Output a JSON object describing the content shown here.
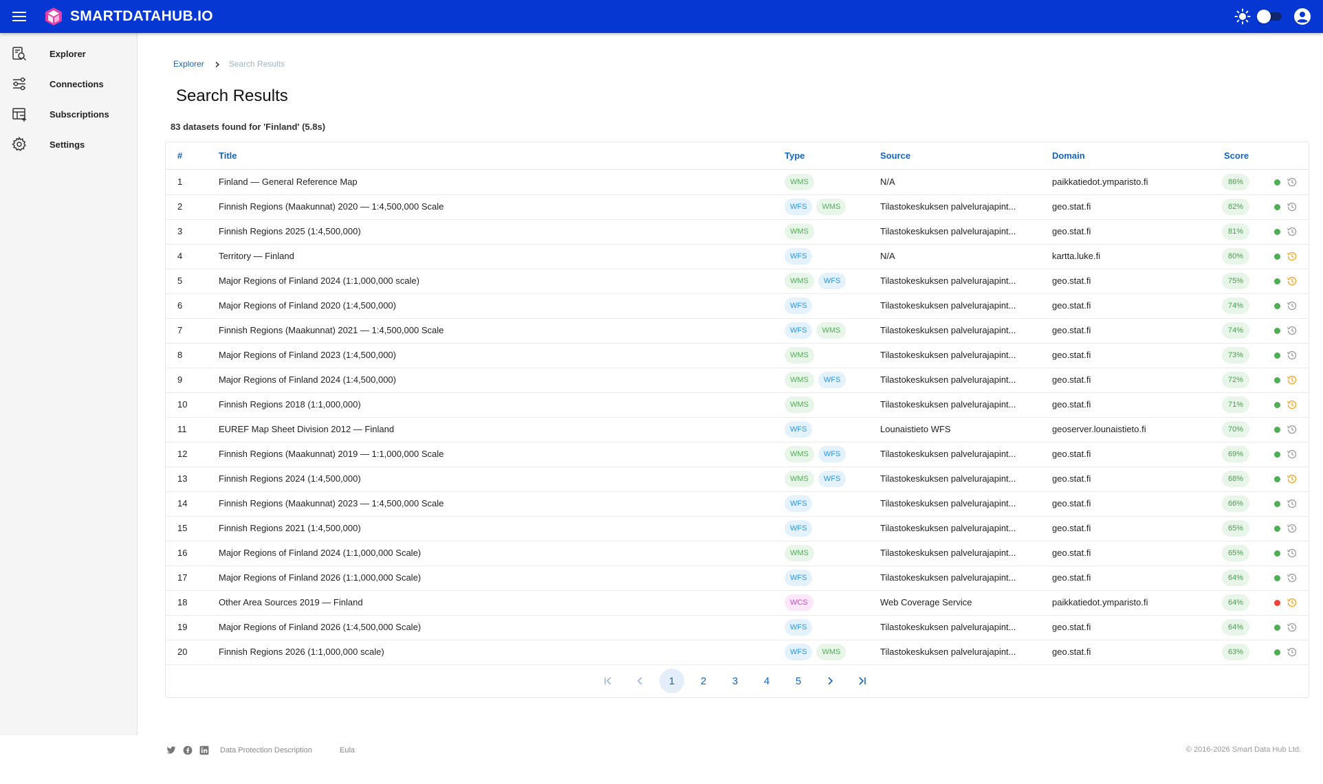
{
  "header": {
    "brand": "SMARTDATAHUB.IO"
  },
  "sidebar": {
    "items": [
      {
        "label": "Explorer",
        "icon": "explorer-icon"
      },
      {
        "label": "Connections",
        "icon": "connections-icon"
      },
      {
        "label": "Subscriptions",
        "icon": "subscriptions-icon"
      },
      {
        "label": "Settings",
        "icon": "gear-icon"
      }
    ]
  },
  "breadcrumb": {
    "root": "Explorer",
    "current": "Search Results"
  },
  "page": {
    "title": "Search Results",
    "summary": "83 datasets found for 'Finland' (5.8s)"
  },
  "table": {
    "headers": {
      "num": "#",
      "title": "Title",
      "type": "Type",
      "source": "Source",
      "domain": "Domain",
      "score": "Score"
    },
    "rows": [
      {
        "num": "1",
        "title": "Finland — General Reference Map",
        "types": [
          "WMS"
        ],
        "source": "N/A",
        "domain": "paikkatiedot.ymparisto.fi",
        "score": "86%",
        "status": "green",
        "history": "gray"
      },
      {
        "num": "2",
        "title": "Finnish Regions (Maakunnat) 2020 — 1:4,500,000 Scale",
        "types": [
          "WFS",
          "WMS"
        ],
        "source": "Tilastokeskuksen palvelurajapint...",
        "domain": "geo.stat.fi",
        "score": "82%",
        "status": "green",
        "history": "gray"
      },
      {
        "num": "3",
        "title": "Finnish Regions 2025 (1:4,500,000)",
        "types": [
          "WMS"
        ],
        "source": "Tilastokeskuksen palvelurajapint...",
        "domain": "geo.stat.fi",
        "score": "81%",
        "status": "green",
        "history": "gray"
      },
      {
        "num": "4",
        "title": "Territory — Finland",
        "types": [
          "WFS"
        ],
        "source": "N/A",
        "domain": "kartta.luke.fi",
        "score": "80%",
        "status": "green",
        "history": "orange"
      },
      {
        "num": "5",
        "title": "Major Regions of Finland 2024 (1:1,000,000 scale)",
        "types": [
          "WMS",
          "WFS"
        ],
        "source": "Tilastokeskuksen palvelurajapint...",
        "domain": "geo.stat.fi",
        "score": "75%",
        "status": "green",
        "history": "orange"
      },
      {
        "num": "6",
        "title": "Major Regions of Finland 2020 (1:4,500,000)",
        "types": [
          "WFS"
        ],
        "source": "Tilastokeskuksen palvelurajapint...",
        "domain": "geo.stat.fi",
        "score": "74%",
        "status": "green",
        "history": "gray"
      },
      {
        "num": "7",
        "title": "Finnish Regions (Maakunnat) 2021 — 1:4,500,000 Scale",
        "types": [
          "WFS",
          "WMS"
        ],
        "source": "Tilastokeskuksen palvelurajapint...",
        "domain": "geo.stat.fi",
        "score": "74%",
        "status": "green",
        "history": "gray"
      },
      {
        "num": "8",
        "title": "Major Regions of Finland 2023 (1:4,500,000)",
        "types": [
          "WMS"
        ],
        "source": "Tilastokeskuksen palvelurajapint...",
        "domain": "geo.stat.fi",
        "score": "73%",
        "status": "green",
        "history": "gray"
      },
      {
        "num": "9",
        "title": "Major Regions of Finland 2024 (1:4,500,000)",
        "types": [
          "WMS",
          "WFS"
        ],
        "source": "Tilastokeskuksen palvelurajapint...",
        "domain": "geo.stat.fi",
        "score": "72%",
        "status": "green",
        "history": "orange"
      },
      {
        "num": "10",
        "title": "Finnish Regions 2018 (1:1,000,000)",
        "types": [
          "WMS"
        ],
        "source": "Tilastokeskuksen palvelurajapint...",
        "domain": "geo.stat.fi",
        "score": "71%",
        "status": "green",
        "history": "orange"
      },
      {
        "num": "11",
        "title": "EUREF Map Sheet Division 2012 — Finland",
        "types": [
          "WFS"
        ],
        "source": "Lounaistieto WFS",
        "domain": "geoserver.lounaistieto.fi",
        "score": "70%",
        "status": "green",
        "history": "gray"
      },
      {
        "num": "12",
        "title": "Finnish Regions (Maakunnat) 2019 — 1:1,000,000 Scale",
        "types": [
          "WMS",
          "WFS"
        ],
        "source": "Tilastokeskuksen palvelurajapint...",
        "domain": "geo.stat.fi",
        "score": "69%",
        "status": "green",
        "history": "gray"
      },
      {
        "num": "13",
        "title": "Finnish Regions 2024 (1:4,500,000)",
        "types": [
          "WMS",
          "WFS"
        ],
        "source": "Tilastokeskuksen palvelurajapint...",
        "domain": "geo.stat.fi",
        "score": "68%",
        "status": "green",
        "history": "orange"
      },
      {
        "num": "14",
        "title": "Finnish Regions (Maakunnat) 2023 — 1:4,500,000 Scale",
        "types": [
          "WFS"
        ],
        "source": "Tilastokeskuksen palvelurajapint...",
        "domain": "geo.stat.fi",
        "score": "66%",
        "status": "green",
        "history": "gray"
      },
      {
        "num": "15",
        "title": "Finnish Regions 2021 (1:4,500,000)",
        "types": [
          "WFS"
        ],
        "source": "Tilastokeskuksen palvelurajapint...",
        "domain": "geo.stat.fi",
        "score": "65%",
        "status": "green",
        "history": "gray"
      },
      {
        "num": "16",
        "title": "Major Regions of Finland 2024 (1:1,000,000 Scale)",
        "types": [
          "WMS"
        ],
        "source": "Tilastokeskuksen palvelurajapint...",
        "domain": "geo.stat.fi",
        "score": "65%",
        "status": "green",
        "history": "gray"
      },
      {
        "num": "17",
        "title": "Major Regions of Finland 2026 (1:1,000,000 Scale)",
        "types": [
          "WFS"
        ],
        "source": "Tilastokeskuksen palvelurajapint...",
        "domain": "geo.stat.fi",
        "score": "64%",
        "status": "green",
        "history": "gray"
      },
      {
        "num": "18",
        "title": "Other Area Sources 2019 — Finland",
        "types": [
          "WCS"
        ],
        "source": "Web Coverage Service",
        "domain": "paikkatiedot.ymparisto.fi",
        "score": "64%",
        "status": "red",
        "history": "orange"
      },
      {
        "num": "19",
        "title": "Major Regions of Finland 2026 (1:4,500,000 Scale)",
        "types": [
          "WFS"
        ],
        "source": "Tilastokeskuksen palvelurajapint...",
        "domain": "geo.stat.fi",
        "score": "64%",
        "status": "green",
        "history": "gray"
      },
      {
        "num": "20",
        "title": "Finnish Regions 2026 (1:1,000,000 scale)",
        "types": [
          "WFS",
          "WMS"
        ],
        "source": "Tilastokeskuksen palvelurajapint...",
        "domain": "geo.stat.fi",
        "score": "63%",
        "status": "green",
        "history": "gray"
      }
    ]
  },
  "pagination": {
    "pages": [
      "1",
      "2",
      "3",
      "4",
      "5"
    ],
    "current": "1"
  },
  "footer": {
    "links": [
      "Data Protection Description",
      "Eula"
    ],
    "copyright": "© 2016-2026 Smart Data Hub Ltd."
  },
  "colors": {
    "header_bg": "#0637d3",
    "accent": "#1565c0",
    "status_green": "#4caf50",
    "status_red": "#f44336",
    "history_orange": "#f5a623",
    "history_gray": "#9e9e9e"
  }
}
